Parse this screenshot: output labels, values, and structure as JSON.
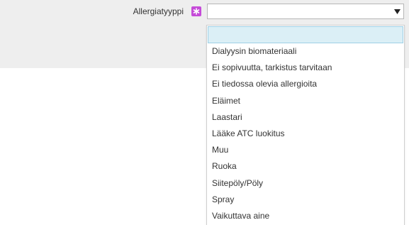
{
  "field": {
    "label": "Allergiatyyppi",
    "required_icon": "required-star-icon",
    "value": ""
  },
  "dropdown": {
    "arrow_icon": "chevron-down-icon",
    "options": [
      "",
      "Dialyysin biomateriaali",
      "Ei sopivuutta, tarkistus tarvitaan",
      "Ei tiedossa olevia allergioita",
      "Eläimet",
      "Laastari",
      "Lääke ATC luokitus",
      "Muu",
      "Ruoka",
      "Siitepöly/Pöly",
      "Spray",
      "Vaikuttava aine"
    ],
    "highlighted_index": 0
  },
  "colors": {
    "required_icon": "#c54bd8",
    "highlight_bg": "#dbeff6",
    "highlight_border": "#9ed0e6",
    "form_bg": "#eeeeee"
  }
}
